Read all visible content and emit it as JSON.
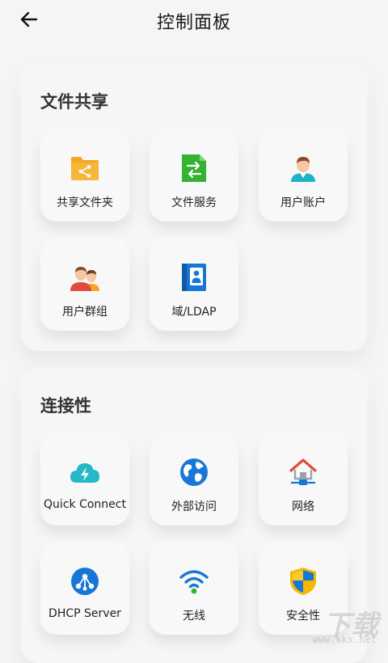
{
  "header": {
    "title": "控制面板"
  },
  "sections": [
    {
      "title": "文件共享",
      "items": [
        {
          "label": "共享文件夹",
          "icon": "shared-folder-icon"
        },
        {
          "label": "文件服务",
          "icon": "file-service-icon"
        },
        {
          "label": "用户账户",
          "icon": "user-account-icon"
        },
        {
          "label": "用户群组",
          "icon": "user-group-icon"
        },
        {
          "label": "域/LDAP",
          "icon": "ldap-icon"
        }
      ]
    },
    {
      "title": "连接性",
      "items": [
        {
          "label": "Quick Connect",
          "icon": "quick-connect-icon"
        },
        {
          "label": "外部访问",
          "icon": "globe-icon"
        },
        {
          "label": "网络",
          "icon": "network-icon"
        },
        {
          "label": "DHCP Server",
          "icon": "dhcp-icon"
        },
        {
          "label": "无线",
          "icon": "wifi-icon"
        },
        {
          "label": "安全性",
          "icon": "shield-icon"
        }
      ]
    }
  ],
  "watermark": {
    "big": "下载",
    "small": "www.kkx.net"
  },
  "colors": {
    "folder": "#f5a623",
    "file_service": "#34b233",
    "cloud": "#26b7c9",
    "blue": "#1677d6",
    "shield": "#f5b800"
  }
}
